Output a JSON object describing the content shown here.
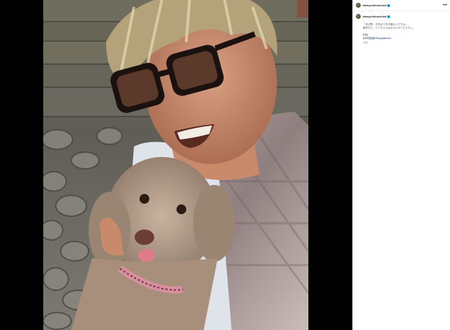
{
  "post": {
    "username": "takuya.kimura.tak",
    "caption_lines": [
      "「中辺野、お花わり冬が暖かいですね…",
      "頑学から、ワンちゃんはかわいかったです♪」",
      "",
      "拓哉",
      "#木村拓哉#Takuyakimura"
    ],
    "date": "3週間",
    "more_label": "•••"
  },
  "colors": {
    "verified": "#0095f6",
    "link": "#00376b"
  },
  "icons": {
    "more": "more-options-icon",
    "verified": "verified-badge-icon"
  }
}
